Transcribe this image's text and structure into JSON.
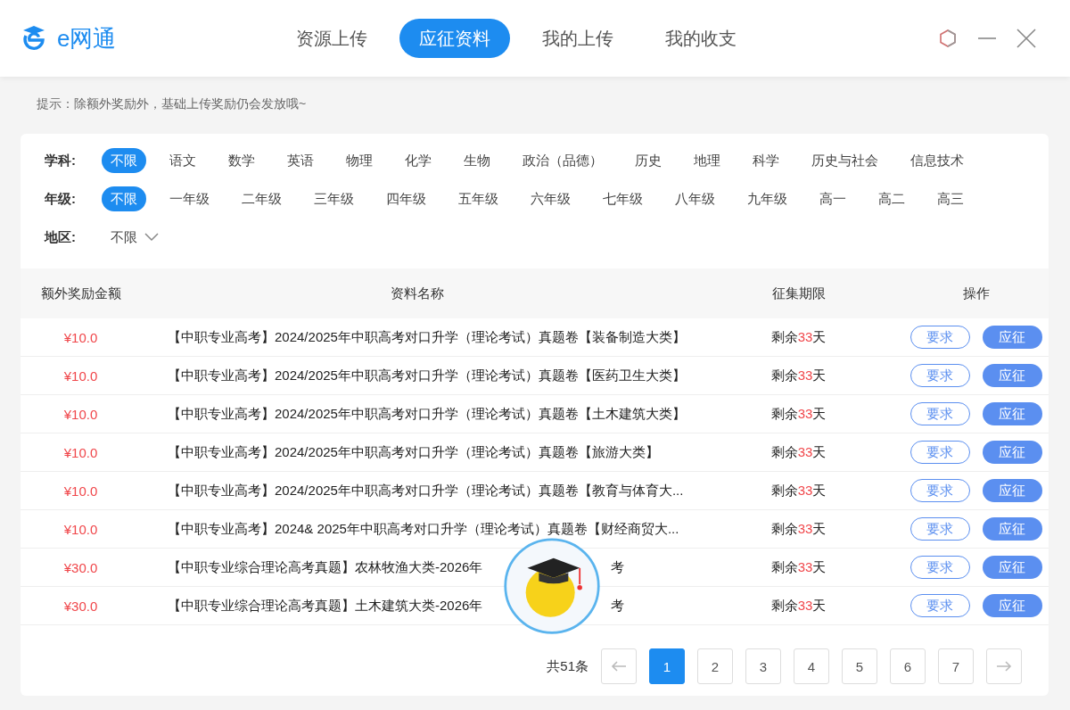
{
  "app": {
    "name": "e网通"
  },
  "nav_tabs": [
    {
      "label": "资源上传",
      "selected": false
    },
    {
      "label": "应征资料",
      "selected": true
    },
    {
      "label": "我的上传",
      "selected": false
    },
    {
      "label": "我的收支",
      "selected": false
    }
  ],
  "hint": "提示：除额外奖励外，基础上传奖励仍会发放哦~",
  "filters": [
    {
      "kind": "tags",
      "label": "学科:",
      "options": [
        {
          "label": "不限",
          "selected": true
        },
        {
          "label": "语文",
          "selected": false
        },
        {
          "label": "数学",
          "selected": false
        },
        {
          "label": "英语",
          "selected": false
        },
        {
          "label": "物理",
          "selected": false
        },
        {
          "label": "化学",
          "selected": false
        },
        {
          "label": "生物",
          "selected": false
        },
        {
          "label": "政治（品德）",
          "selected": false
        },
        {
          "label": "历史",
          "selected": false
        },
        {
          "label": "地理",
          "selected": false
        },
        {
          "label": "科学",
          "selected": false
        },
        {
          "label": "历史与社会",
          "selected": false
        },
        {
          "label": "信息技术",
          "selected": false
        }
      ]
    },
    {
      "kind": "tags",
      "label": "年级:",
      "options": [
        {
          "label": "不限",
          "selected": true
        },
        {
          "label": "一年级",
          "selected": false
        },
        {
          "label": "二年级",
          "selected": false
        },
        {
          "label": "三年级",
          "selected": false
        },
        {
          "label": "四年级",
          "selected": false
        },
        {
          "label": "五年级",
          "selected": false
        },
        {
          "label": "六年级",
          "selected": false
        },
        {
          "label": "七年级",
          "selected": false
        },
        {
          "label": "八年级",
          "selected": false
        },
        {
          "label": "九年级",
          "selected": false
        },
        {
          "label": "高一",
          "selected": false
        },
        {
          "label": "高二",
          "selected": false
        },
        {
          "label": "高三",
          "selected": false
        }
      ]
    },
    {
      "kind": "dropdown",
      "label": "地区:",
      "value": "不限"
    }
  ],
  "table": {
    "columns": [
      "额外奖励金额",
      "资料名称",
      "征集期限",
      "操作"
    ],
    "rows": [
      {
        "reward": "¥10.0",
        "title": "【中职专业高考】2024/2025年中职高考对口升学（理论考试）真题卷【装备制造大类】",
        "deadline": {
          "prefix": "剩余",
          "days": "33",
          "suffix": "天"
        },
        "actions": [
          "要求",
          "应征"
        ]
      },
      {
        "reward": "¥10.0",
        "title": "【中职专业高考】2024/2025年中职高考对口升学（理论考试）真题卷【医药卫生大类】",
        "deadline": {
          "prefix": "剩余",
          "days": "33",
          "suffix": "天"
        },
        "actions": [
          "要求",
          "应征"
        ]
      },
      {
        "reward": "¥10.0",
        "title": "【中职专业高考】2024/2025年中职高考对口升学（理论考试）真题卷【土木建筑大类】",
        "deadline": {
          "prefix": "剩余",
          "days": "33",
          "suffix": "天"
        },
        "actions": [
          "要求",
          "应征"
        ]
      },
      {
        "reward": "¥10.0",
        "title": "【中职专业高考】2024/2025年中职高考对口升学（理论考试）真题卷【旅游大类】",
        "deadline": {
          "prefix": "剩余",
          "days": "33",
          "suffix": "天"
        },
        "actions": [
          "要求",
          "应征"
        ]
      },
      {
        "reward": "¥10.0",
        "title": "【中职专业高考】2024/2025年中职高考对口升学（理论考试）真题卷【教育与体育大...",
        "deadline": {
          "prefix": "剩余",
          "days": "33",
          "suffix": "天"
        },
        "actions": [
          "要求",
          "应征"
        ]
      },
      {
        "reward": "¥10.0",
        "title": "【中职专业高考】2024& 2025年中职高考对口升学（理论考试）真题卷【财经商贸大...",
        "deadline": {
          "prefix": "剩余",
          "days": "33",
          "suffix": "天"
        },
        "actions": [
          "要求",
          "应征"
        ]
      },
      {
        "reward": "¥30.0",
        "title": "【中职专业综合理论高考真题】农林牧渔大类-2026年",
        "title_tail": "考",
        "deadline": {
          "prefix": "剩余",
          "days": "33",
          "suffix": "天"
        },
        "actions": [
          "要求",
          "应征"
        ]
      },
      {
        "reward": "¥30.0",
        "title": "【中职专业综合理论高考真题】土木建筑大类-2026年",
        "title_tail": "考",
        "deadline": {
          "prefix": "剩余",
          "days": "33",
          "suffix": "天"
        },
        "actions": [
          "要求",
          "应征"
        ]
      }
    ]
  },
  "pagination": {
    "total": "共51条",
    "pages": [
      {
        "label": "1",
        "selected": true
      },
      {
        "label": "2",
        "selected": false
      },
      {
        "label": "3",
        "selected": false
      },
      {
        "label": "4",
        "selected": false
      },
      {
        "label": "5",
        "selected": false
      },
      {
        "label": "6",
        "selected": false
      },
      {
        "label": "7",
        "selected": false
      }
    ]
  }
}
